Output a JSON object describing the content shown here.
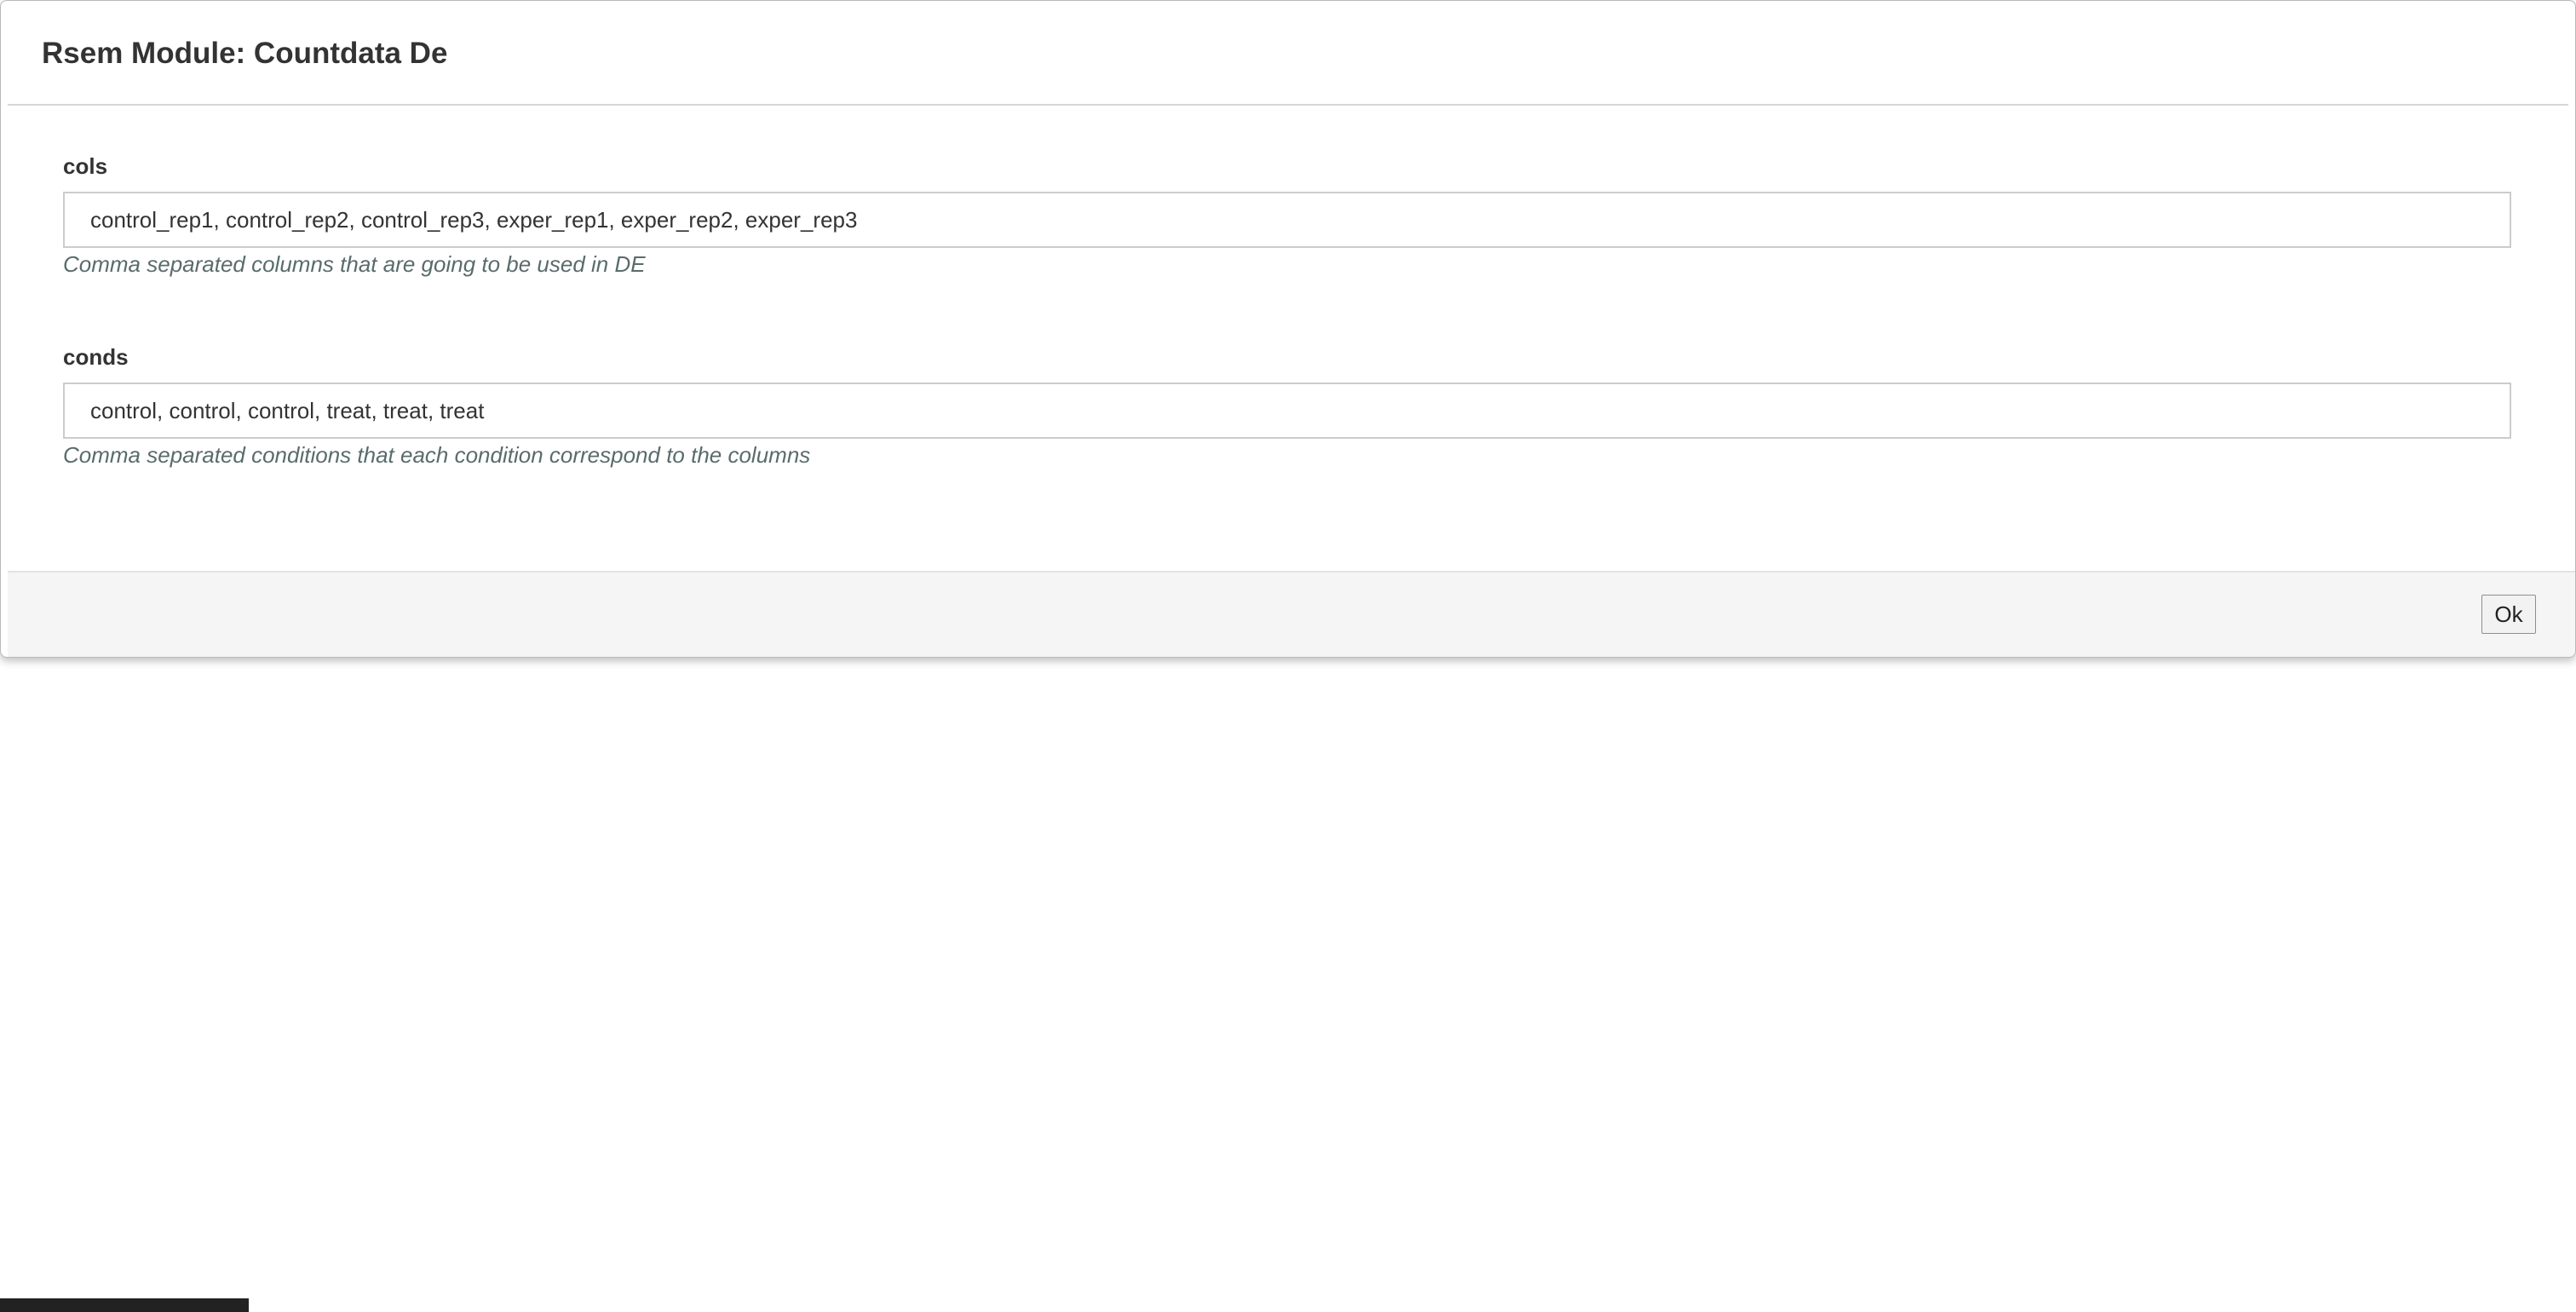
{
  "modal": {
    "title": "Rsem Module: Countdata De",
    "fields": [
      {
        "label": "cols",
        "value": "control_rep1, control_rep2, control_rep3, exper_rep1, exper_rep2, exper_rep3",
        "help": "Comma separated columns that are going to be used in DE"
      },
      {
        "label": "conds",
        "value": "control, control, control, treat, treat, treat",
        "help": "Comma separated conditions that each condition correspond to the columns"
      }
    ],
    "footer": {
      "ok_label": "Ok"
    }
  }
}
